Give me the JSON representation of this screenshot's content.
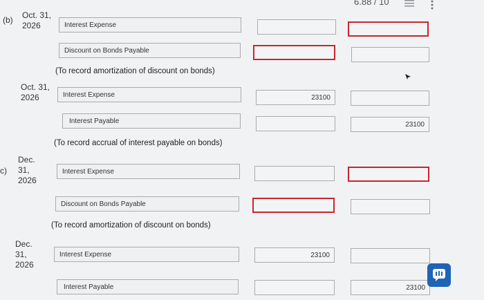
{
  "header": {
    "score_text": "6.88 / 10",
    "list_icon": "list-icon",
    "more_icon": "more-icon"
  },
  "part_b": {
    "label": "(b)",
    "entry1": {
      "date_line1": "Oct. 31,",
      "date_line2": "2026",
      "debit_account": "Interest Expense",
      "credit_account": "Discount on Bonds Payable",
      "note": "(To record amortization of discount on bonds)"
    },
    "entry2": {
      "date_line1": "Oct. 31,",
      "date_line2": "2026",
      "debit_account": "Interest Expense",
      "debit_amount": "23100",
      "credit_account": "Interest Payable",
      "credit_amount": "23100",
      "note": "(To record accrual of interest payable on bonds)"
    }
  },
  "part_c": {
    "label": "c)",
    "entry1": {
      "date_line1": "Dec.",
      "date_line2": "31,",
      "date_line3": "2026",
      "debit_account": "Interest Expense",
      "credit_account": "Discount on Bonds Payable",
      "note": "(To record amortization of discount on bonds)"
    },
    "entry2": {
      "date_line1": "Dec.",
      "date_line2": "31,",
      "date_line3": "2026",
      "debit_account": "Interest Expense",
      "debit_amount": "23100",
      "credit_account": "Interest Payable",
      "credit_amount": "23100"
    }
  },
  "colors": {
    "error_border": "#c8252e",
    "chat_button": "#1e63b5"
  }
}
